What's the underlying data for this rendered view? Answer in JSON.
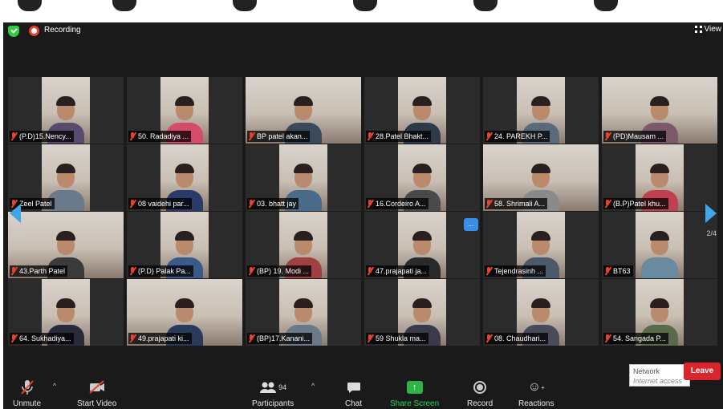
{
  "colors": {
    "accent": "#3fa6e8",
    "recording": "#e8412c",
    "share": "#2fb344",
    "leave": "#d7262c"
  },
  "topbar": {
    "recording_label": "Recording",
    "view_label": "View"
  },
  "pagination": {
    "left": "2/4",
    "right": "2/4"
  },
  "participants": [
    {
      "name": "(P.D)15.Nency..."
    },
    {
      "name": "50. Radadiya ..."
    },
    {
      "name": "BP patel akan..."
    },
    {
      "name": "28.Patel Bhakt..."
    },
    {
      "name": "24. PAREKH P..."
    },
    {
      "name": "(PD)Mausam ..."
    },
    {
      "name": "Zeel Patel"
    },
    {
      "name": "08 vaidehi par..."
    },
    {
      "name": "03. bhatt jay"
    },
    {
      "name": "16.Cordeiro A..."
    },
    {
      "name": "58. Shrimali A..."
    },
    {
      "name": "(B.P)Patel khu..."
    },
    {
      "name": "43.Parth Patel"
    },
    {
      "name": "(P.D) Palak Pa..."
    },
    {
      "name": "(BP) 19. Modi ..."
    },
    {
      "name": "47.prajapati ja..."
    },
    {
      "name": "Tejendrasinh ..."
    },
    {
      "name": "BT63"
    },
    {
      "name": "64. Sukhadiya..."
    },
    {
      "name": "49.prajapati ki..."
    },
    {
      "name": "(BP)17.Kanani..."
    },
    {
      "name": "59 Shukla ma..."
    },
    {
      "name": "08. Chaudhari..."
    },
    {
      "name": "54. Sangada P..."
    }
  ],
  "more_label": "...",
  "toolbar": {
    "unmute": "Unmute",
    "start_video": "Start Video",
    "participants": "Participants",
    "participant_count": "94",
    "chat": "Chat",
    "share_screen": "Share Screen",
    "record": "Record",
    "reactions": "Reactions",
    "leave": "Leave"
  },
  "network_popup": {
    "title": "Network",
    "subtitle": "Internet access"
  }
}
